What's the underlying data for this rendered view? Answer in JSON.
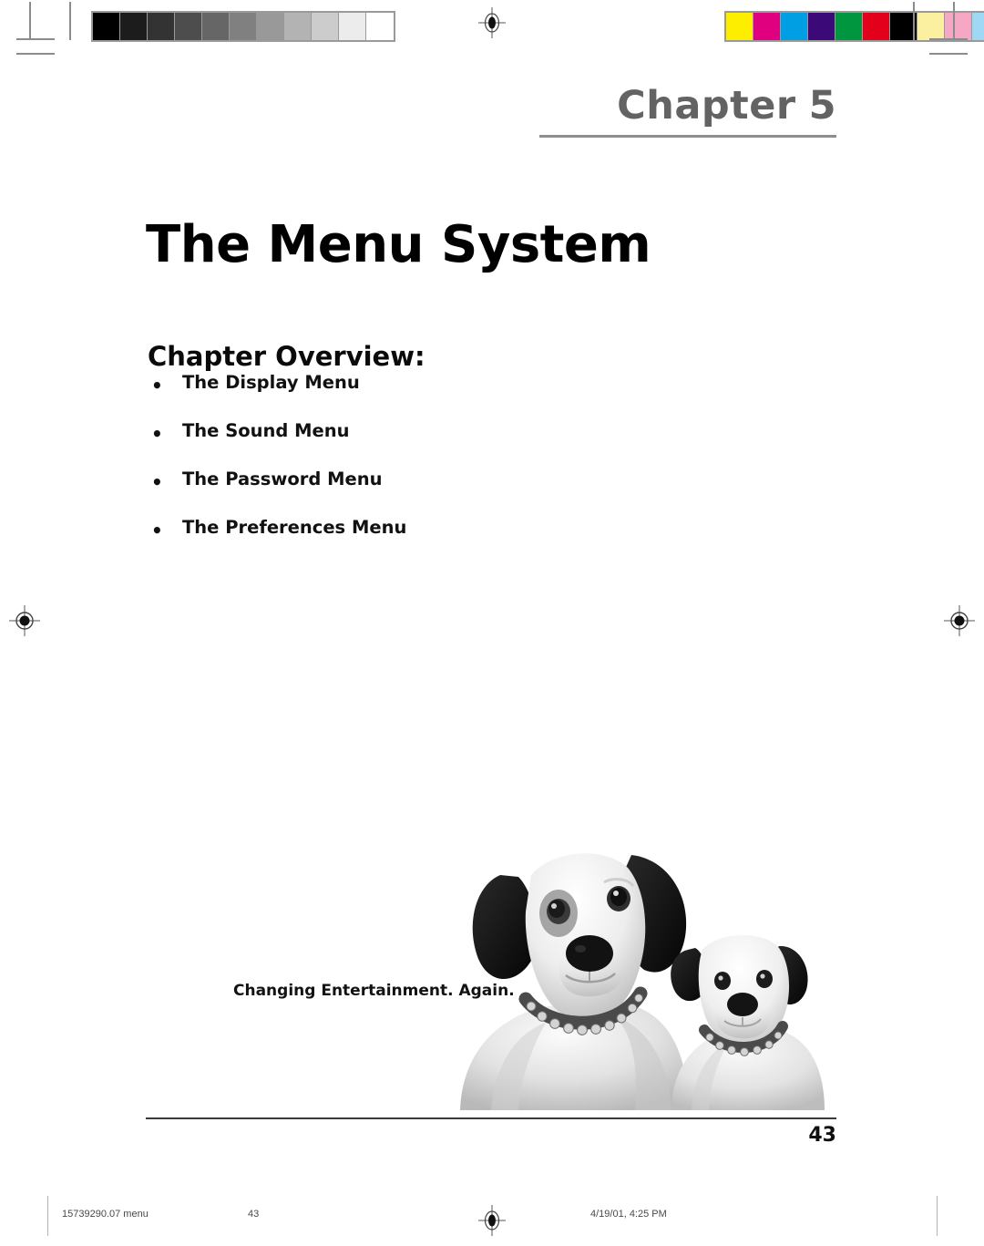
{
  "document": {
    "chapter_label": "Chapter",
    "chapter_number": "5",
    "title": "The Menu System",
    "page_number": "43"
  },
  "overview": {
    "heading": "Chapter Overview:",
    "bullet_glyph": "•",
    "items": [
      {
        "label": "The Display Menu"
      },
      {
        "label": "The Sound Menu"
      },
      {
        "label": "The Password Menu"
      },
      {
        "label": "The Preferences Menu"
      }
    ]
  },
  "brand": {
    "tagline": "Changing Entertainment. Again."
  },
  "photo": {
    "name": "two-dogs-photo",
    "description": "Black and white photograph of two dogs wearing studded collars"
  },
  "print_footer": {
    "doc_id": "15739290.07 menu",
    "page": "43",
    "timestamp": "4/19/01, 4:25 PM"
  },
  "calibration": {
    "grayscale_name": "grayscale-calibration-strip",
    "grayscale_swatches": [
      "#000000",
      "#1c1c1c",
      "#333333",
      "#4d4d4d",
      "#666666",
      "#808080",
      "#999999",
      "#b3b3b3",
      "#cccccc",
      "#ececec",
      "#ffffff"
    ],
    "color_name": "color-calibration-strip",
    "color_swatches": [
      "#fdee00",
      "#e0007f",
      "#009fe3",
      "#3b0a78",
      "#00963f",
      "#e3001b",
      "#000000",
      "#faf0a0",
      "#f6a7c4",
      "#9ed8f5",
      "#a6a6a6"
    ]
  },
  "marks": {
    "registration_mark_name": "registration-mark",
    "crop_mark_name": "crop-mark"
  }
}
